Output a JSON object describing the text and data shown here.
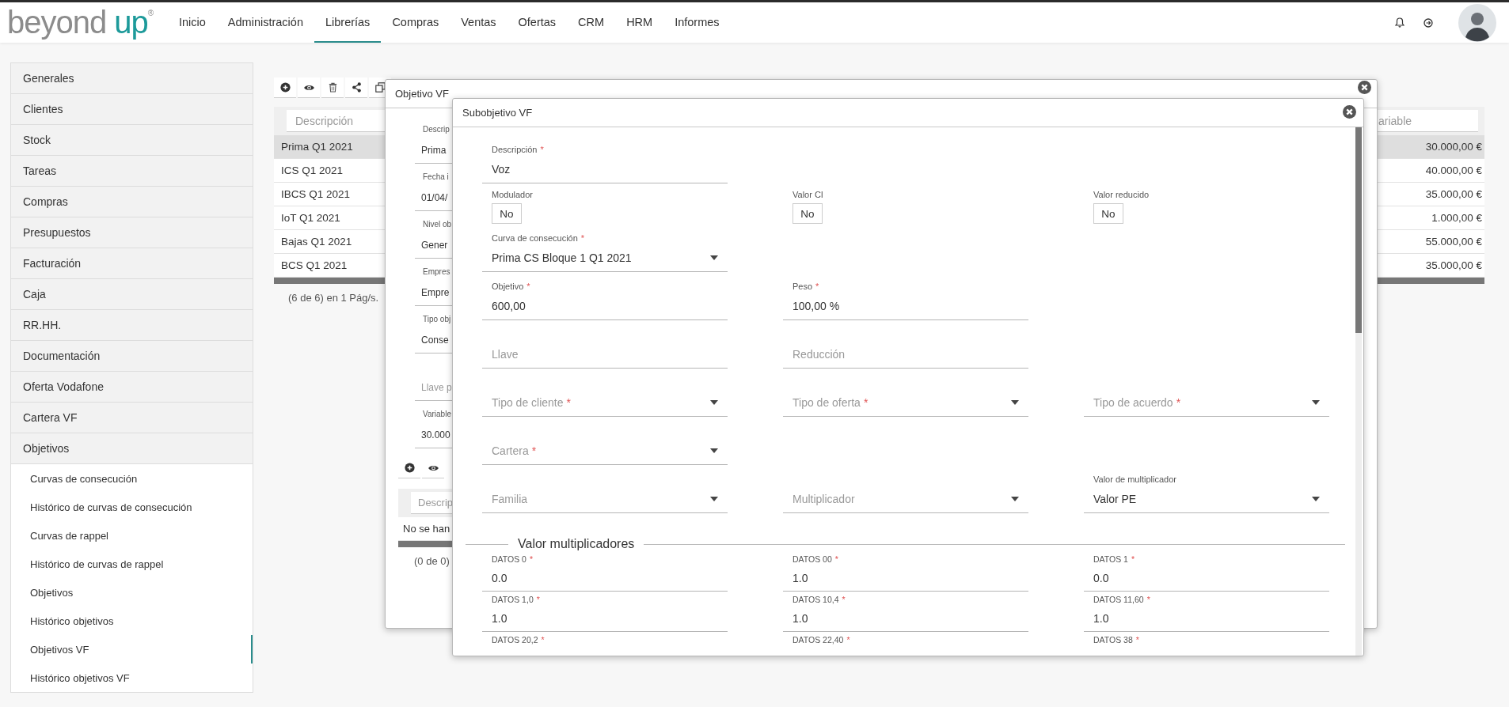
{
  "logo": {
    "text": "beyond",
    "accent": "up",
    "mark": "®"
  },
  "nav": [
    {
      "label": "Inicio",
      "selected": false
    },
    {
      "label": "Administración",
      "selected": false
    },
    {
      "label": "Librerías",
      "selected": true
    },
    {
      "label": "Compras",
      "selected": false
    },
    {
      "label": "Ventas",
      "selected": false
    },
    {
      "label": "Ofertas",
      "selected": false
    },
    {
      "label": "CRM",
      "selected": false
    },
    {
      "label": "HRM",
      "selected": false
    },
    {
      "label": "Informes",
      "selected": false
    }
  ],
  "sidebar": {
    "items": [
      {
        "label": "Generales"
      },
      {
        "label": "Clientes"
      },
      {
        "label": "Stock"
      },
      {
        "label": "Tareas"
      },
      {
        "label": "Compras"
      },
      {
        "label": "Presupuestos"
      },
      {
        "label": "Facturación"
      },
      {
        "label": "Caja"
      },
      {
        "label": "RR.HH."
      },
      {
        "label": "Documentación"
      },
      {
        "label": "Oferta Vodafone"
      },
      {
        "label": "Cartera VF"
      },
      {
        "label": "Objetivos",
        "children": [
          {
            "label": "Curvas de consecución",
            "selected": false
          },
          {
            "label": "Histórico de curvas de consecución",
            "selected": false
          },
          {
            "label": "Curvas de rappel",
            "selected": false
          },
          {
            "label": "Histórico de curvas de rappel",
            "selected": false
          },
          {
            "label": "Objetivos",
            "selected": false
          },
          {
            "label": "Histórico objetivos",
            "selected": false
          },
          {
            "label": "Objetivos VF",
            "selected": true
          },
          {
            "label": "Histórico objetivos VF",
            "selected": false
          }
        ]
      }
    ]
  },
  "table": {
    "filters": {
      "description": "Descripción",
      "column_variable": "ariable"
    },
    "rows": [
      {
        "description": "Prima Q1 2021",
        "amount": "30.000,00 €",
        "selected": true
      },
      {
        "description": "ICS Q1 2021",
        "amount": "40.000,00 €",
        "selected": false
      },
      {
        "description": "IBCS Q1 2021",
        "amount": "35.000,00 €",
        "selected": false
      },
      {
        "description": "IoT Q1 2021",
        "amount": "1.000,00 €",
        "selected": false
      },
      {
        "description": "Bajas Q1 2021",
        "amount": "55.000,00 €",
        "selected": false
      },
      {
        "description": "BCS Q1 2021",
        "amount": "35.000,00 €",
        "selected": false
      }
    ],
    "footer": "(6 de 6) en 1 Pág/s."
  },
  "dialog": {
    "title": "Objetivo VF",
    "fields": [
      {
        "label": "Descrip",
        "value": "Prima"
      },
      {
        "label": "Fecha i",
        "value": "01/04/"
      },
      {
        "label": "Nivel ob",
        "value": "Gener"
      },
      {
        "label": "Empres",
        "value": "Empre"
      },
      {
        "label": "Tipo obj",
        "value": "Conse"
      },
      {
        "placeholder": "Llave p"
      },
      {
        "label": "Variable",
        "value": "30.000"
      }
    ],
    "table": {
      "filter": "Descrip",
      "empty_text": "No se han",
      "footer": "(0 de 0)"
    }
  },
  "subdialog": {
    "title": "Subobjetivo VF",
    "rows": [
      {
        "left": {
          "kind": "input",
          "label": "Descripción",
          "required_mark": "*",
          "value": "Voz"
        }
      },
      {
        "left": {
          "kind": "toggle",
          "label": "Modulador",
          "value": "No"
        },
        "middle": {
          "kind": "toggle",
          "label": "Valor CI",
          "value": "No"
        },
        "right": {
          "kind": "toggle",
          "label": "Valor reducido",
          "value": "No"
        }
      },
      {
        "left": {
          "kind": "select",
          "label": "Curva de consecución",
          "required_mark": "*",
          "value": "Prima CS Bloque 1 Q1 2021"
        }
      },
      {
        "left": {
          "kind": "input",
          "label": "Objetivo",
          "required_mark": "*",
          "value": "600,00"
        },
        "middle": {
          "kind": "input",
          "label": "Peso",
          "required_mark": "*",
          "value": "100,00 %"
        }
      },
      {
        "left": {
          "kind": "input",
          "placeholder": "Llave"
        },
        "middle": {
          "kind": "input",
          "placeholder": "Reducción"
        }
      },
      {
        "left": {
          "kind": "select",
          "placeholder": "Tipo de cliente",
          "required_mark": "*"
        },
        "middle": {
          "kind": "select",
          "placeholder": "Tipo de oferta",
          "required_mark": "*"
        },
        "right": {
          "kind": "select",
          "placeholder": "Tipo de acuerdo",
          "required_mark": "*"
        }
      },
      {
        "left": {
          "kind": "select",
          "placeholder": "Cartera",
          "required_mark": "*"
        }
      },
      {
        "left": {
          "kind": "select",
          "placeholder": "Familia"
        },
        "middle": {
          "kind": "select",
          "placeholder": "Multiplicador"
        },
        "right": {
          "kind": "select",
          "label": "Valor de multiplicador",
          "value": "Valor PE"
        }
      }
    ],
    "section": {
      "title": "Valor multiplicadores",
      "rows": [
        {
          "left": {
            "kind": "input",
            "label": "DATOS 0",
            "required_mark": "*",
            "value": "0.0"
          },
          "middle": {
            "kind": "input",
            "label": "DATOS 00",
            "required_mark": "*",
            "value": "1.0"
          },
          "right": {
            "kind": "input",
            "label": "DATOS 1",
            "required_mark": "*",
            "value": "0.0"
          }
        },
        {
          "left": {
            "kind": "input",
            "label": "DATOS 1,0",
            "required_mark": "*",
            "value": "1.0"
          },
          "middle": {
            "kind": "input",
            "label": "DATOS 10,4",
            "required_mark": "*",
            "value": "1.0"
          },
          "right": {
            "kind": "input",
            "label": "DATOS 11,60",
            "required_mark": "*",
            "value": "1.0"
          }
        },
        {
          "left": {
            "kind": "input",
            "label": "DATOS 20,2",
            "required_mark": "*"
          },
          "middle": {
            "kind": "input",
            "label": "DATOS 22,40",
            "required_mark": "*"
          },
          "right": {
            "kind": "input",
            "label": "DATOS 38",
            "required_mark": "*"
          }
        }
      ]
    }
  }
}
